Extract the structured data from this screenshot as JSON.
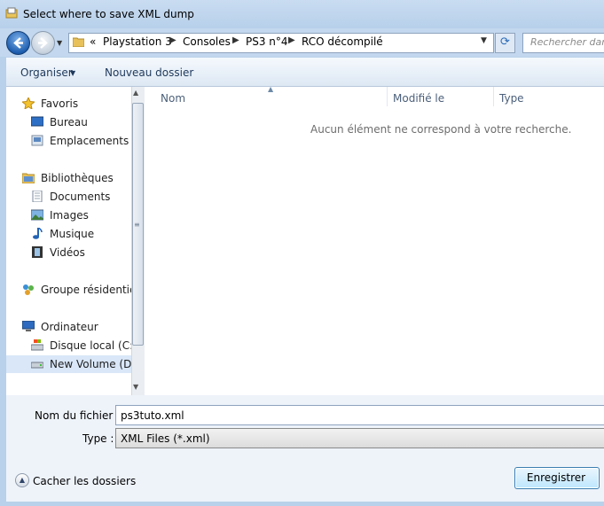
{
  "window": {
    "title": "Select where to save XML dump"
  },
  "address": {
    "crumbs_prefix": "«",
    "crumbs": [
      "Playstation 3",
      "Consoles",
      "PS3 n°4",
      "RCO décompilé"
    ],
    "search_placeholder": "Rechercher dans"
  },
  "toolbar": {
    "organise_label": "Organiser",
    "new_folder_label": "Nouveau dossier"
  },
  "nav": {
    "favorites_header": "Favoris",
    "favorites": [
      "Bureau",
      "Emplacements ré"
    ],
    "libraries_header": "Bibliothèques",
    "libraries": [
      "Documents",
      "Images",
      "Musique",
      "Vidéos"
    ],
    "homegroup": "Groupe résidentiel",
    "computer_header": "Ordinateur",
    "drives": [
      "Disque local (C:)",
      "New Volume (D:)"
    ]
  },
  "filelist": {
    "columns": [
      "Nom",
      "Modifié le",
      "Type"
    ],
    "empty_message": "Aucun élément ne correspond à votre recherche."
  },
  "form": {
    "filename_label": "Nom du fichier :",
    "filename_value": "ps3tuto.xml",
    "type_label": "Type :",
    "type_value": "XML Files (*.xml)"
  },
  "footer": {
    "hide_folders_label": "Cacher les dossiers",
    "save_label": "Enregistrer"
  }
}
